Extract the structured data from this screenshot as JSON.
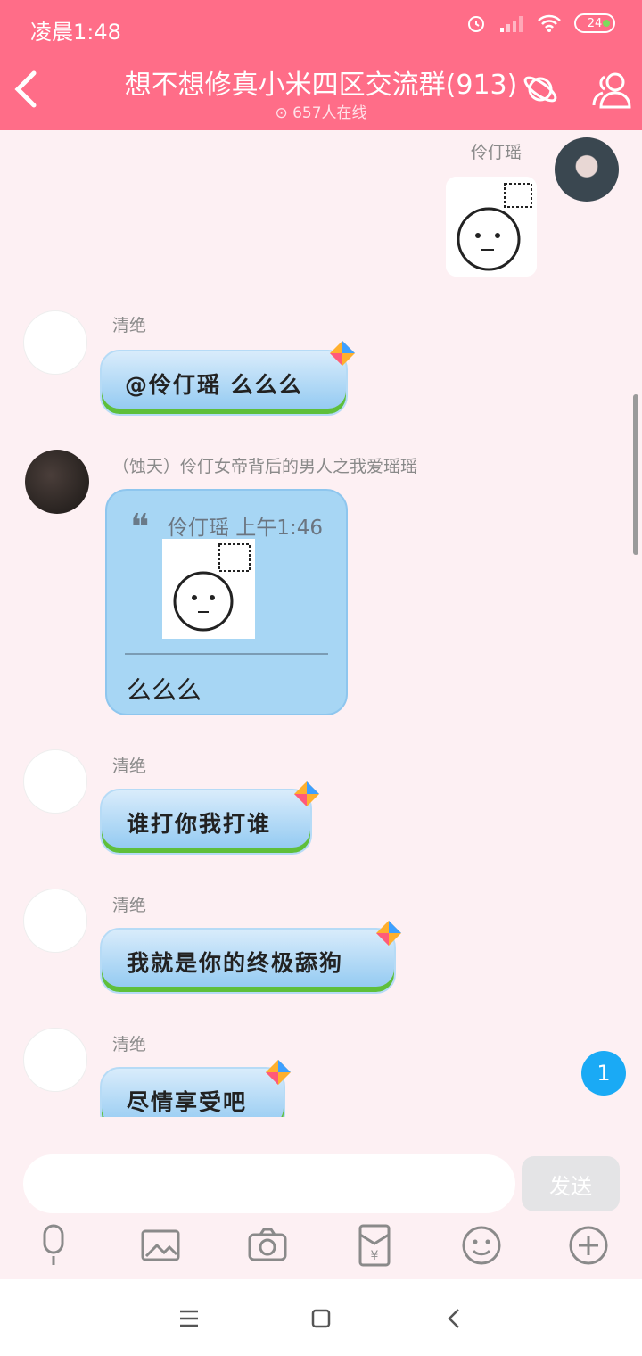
{
  "status": {
    "time": "凌晨1:48",
    "battery": "24"
  },
  "header": {
    "title": "想不想修真小米四区交流群(913)",
    "online": "657人在线"
  },
  "messages": [
    {
      "sender": "伶仃瑶",
      "type": "sticker",
      "side": "right"
    },
    {
      "sender": "清绝",
      "text": "@伶仃瑶 么么么"
    },
    {
      "sender": "（蚀天）伶仃女帝背后的男人之我爱瑶瑶",
      "quote": {
        "author_time": "伶仃瑶 上午1:46"
      },
      "text": "么么么"
    },
    {
      "sender": "清绝",
      "text": "谁打你我打谁"
    },
    {
      "sender": "清绝",
      "text": "我就是你的终极舔狗"
    },
    {
      "sender": "清绝",
      "text": "尽情享受吧"
    }
  ],
  "new_message_badge": "1",
  "composer": {
    "placeholder": "",
    "send_label": "发送"
  },
  "colors": {
    "header_bg": "#ff6d88",
    "chat_bg": "#fdf0f3",
    "bubble_blue": "#a7d6f4",
    "badge": "#1aaaf5"
  },
  "toolbar_icons": [
    "microphone-icon",
    "image-icon",
    "camera-icon",
    "red-packet-icon",
    "emoji-icon",
    "plus-icon"
  ],
  "nav_icons": [
    "menu-icon",
    "home-icon",
    "back-icon"
  ]
}
